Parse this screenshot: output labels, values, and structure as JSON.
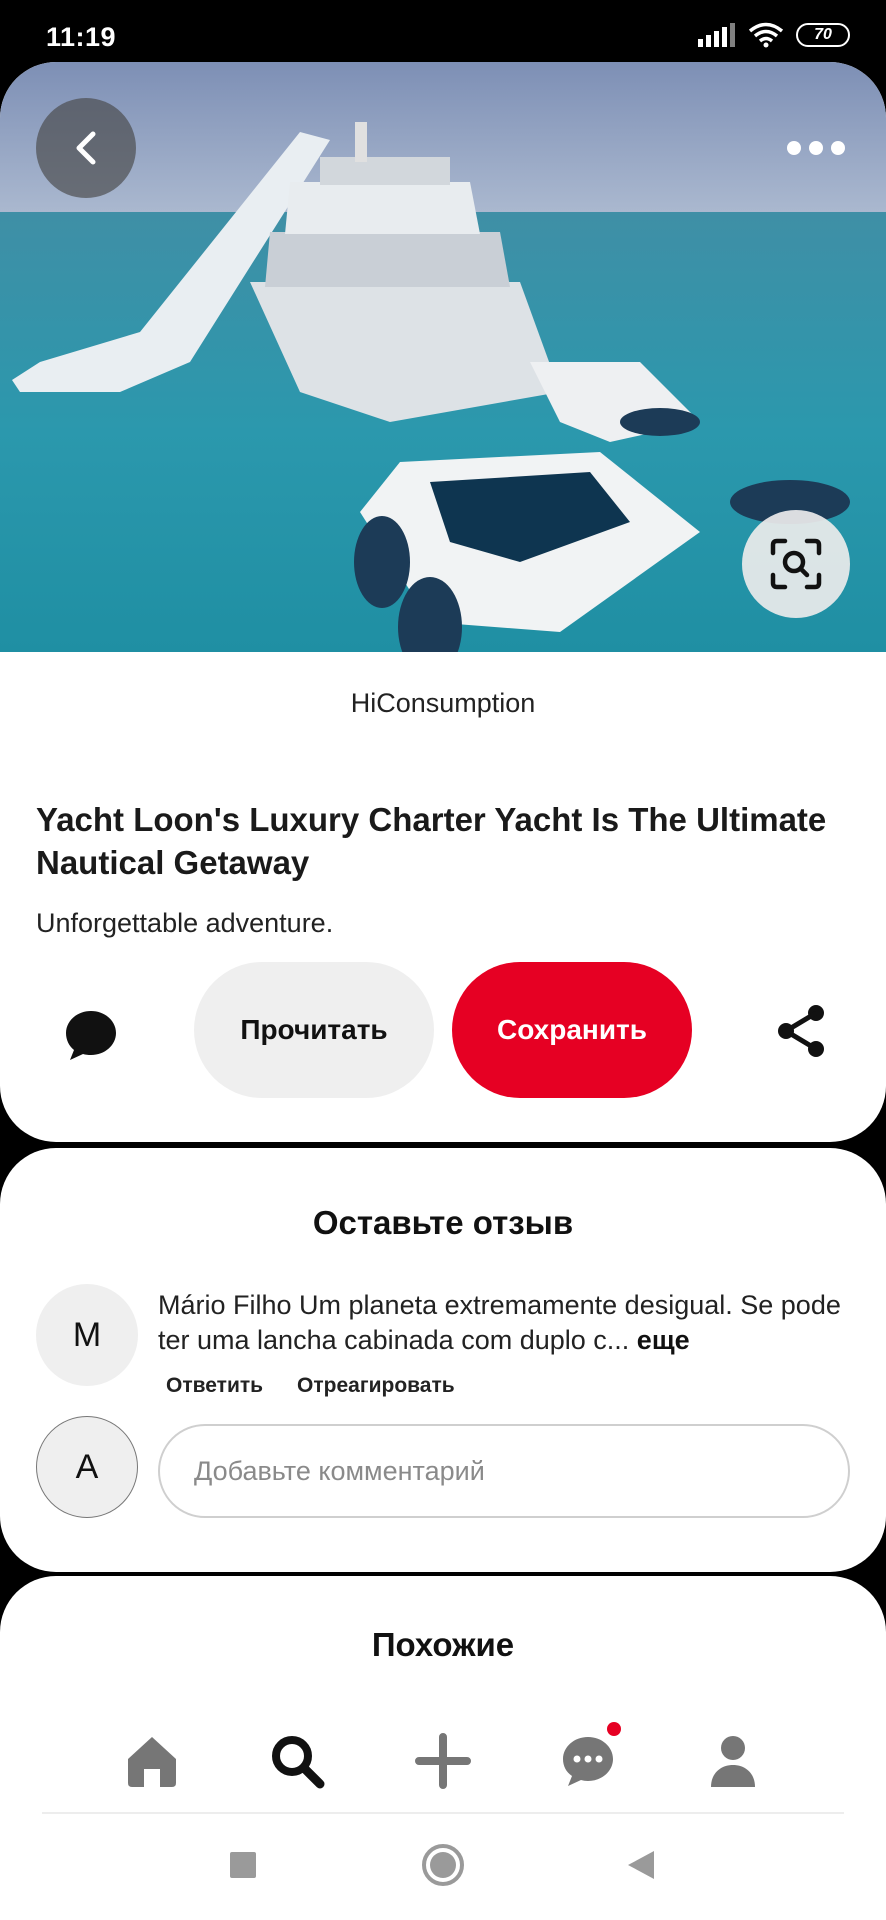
{
  "status_bar": {
    "time": "11:19",
    "battery": "70"
  },
  "pin": {
    "source": "HiConsumption",
    "title": "Yacht Loon's Luxury Charter Yacht Is The Ultimate Nautical Getaway",
    "description": "Unforgettable adventure.",
    "read_label": "Прочитать",
    "save_label": "Сохранить",
    "hero_yacht_name": "Loon"
  },
  "comments": {
    "title": "Оставьте отзыв",
    "items": [
      {
        "avatar_initial": "M",
        "text": "Mário Filho Um planeta extremamente desigual. Se pode ter uma lancha cabinada com duplo c...",
        "more_label": "еще",
        "reply_label": "Ответить",
        "react_label": "Отреагировать"
      }
    ],
    "user_initial": "A",
    "input_placeholder": "Добавьте комментарий"
  },
  "similar": {
    "title": "Похожие"
  },
  "nav": {
    "tabs": [
      "home-icon",
      "search-icon",
      "plus-icon",
      "chat-icon",
      "profile-icon"
    ],
    "active": "search-icon"
  },
  "colors": {
    "accent": "#e60023",
    "secondary_button": "#efefef"
  }
}
